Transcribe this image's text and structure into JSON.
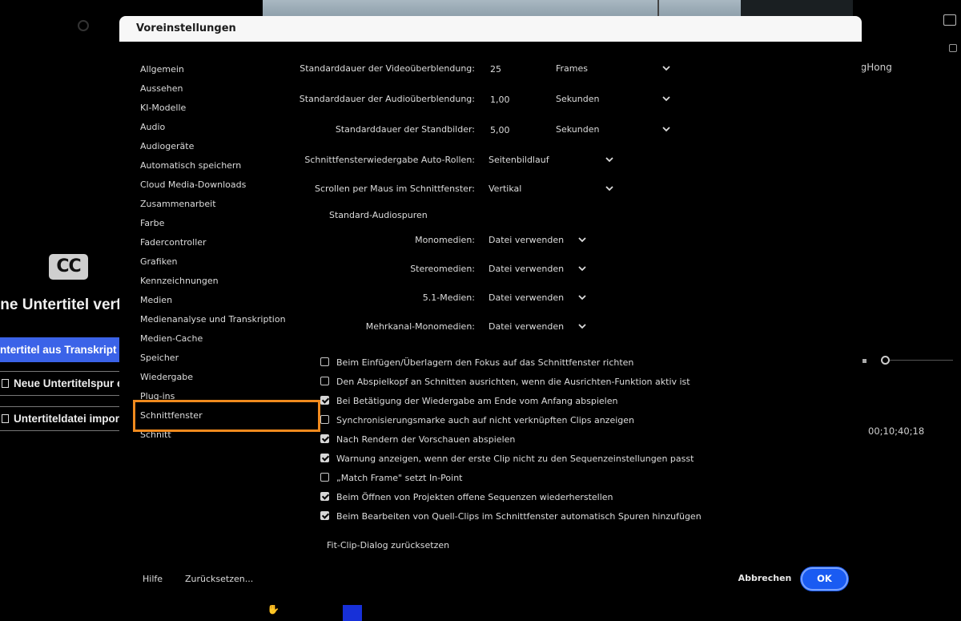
{
  "background": {
    "caption_icon": "CC",
    "title": "ine Untertitel verfü",
    "btn_transcript": "ntertitel aus Transkript ers",
    "btn_new_track": "Neue Untertitelspur ers",
    "btn_import": "Untertiteldatei importi",
    "right_name": "ngHong",
    "timecode": "00;10;40;18"
  },
  "dialog": {
    "title": "Voreinstellungen",
    "sidebar": {
      "items": [
        "Allgemein",
        "Aussehen",
        "KI-Modelle",
        "Audio",
        "Audiogeräte",
        "Automatisch speichern",
        "Cloud Media-Downloads",
        "Zusammenarbeit",
        "Farbe",
        "Fadercontroller",
        "Grafiken",
        "Kennzeichnungen",
        "Medien",
        "Medienanalyse und Transkription",
        "Medien-Cache",
        "Speicher",
        "Wiedergabe",
        "Plug-ins",
        "Schnittfenster",
        "Schnitt"
      ],
      "selected": "Schnittfenster",
      "highlight_color": "#f08a1e"
    },
    "settings": {
      "video_transition": {
        "label": "Standarddauer der Videoüberblendung:",
        "value": "25",
        "unit": "Frames"
      },
      "audio_transition": {
        "label": "Standarddauer der Audioüberblendung:",
        "value": "1,00",
        "unit": "Sekunden"
      },
      "still_duration": {
        "label": "Standarddauer der Standbilder:",
        "value": "5,00",
        "unit": "Sekunden"
      },
      "auto_scroll": {
        "label": "Schnittfensterwiedergabe Auto-Rollen:",
        "value": "Seitenbildlauf"
      },
      "mouse_scroll": {
        "label": "Scrollen per Maus im Schnittfenster:",
        "value": "Vertikal"
      },
      "audio_tracks_heading": "Standard-Audiospuren",
      "mono": {
        "label": "Monomedien:",
        "value": "Datei verwenden"
      },
      "stereo": {
        "label": "Stereomedien:",
        "value": "Datei verwenden"
      },
      "five_one": {
        "label": "5.1-Medien:",
        "value": "Datei verwenden"
      },
      "multichannel": {
        "label": "Mehrkanal-Monomedien:",
        "value": "Datei verwenden"
      }
    },
    "checkboxes": [
      {
        "label": "Beim Einfügen/Überlagern den Fokus auf das Schnittfenster richten",
        "checked": false
      },
      {
        "label": "Den Abspielkopf an Schnitten ausrichten, wenn die Ausrichten-Funktion aktiv ist",
        "checked": false
      },
      {
        "label": "Bei Betätigung der Wiedergabe am Ende vom Anfang abspielen",
        "checked": true
      },
      {
        "label": "Synchronisierungsmarke auch auf nicht verknüpften Clips anzeigen",
        "checked": false
      },
      {
        "label": "Nach Rendern der Vorschauen abspielen",
        "checked": true
      },
      {
        "label": "Warnung anzeigen, wenn der erste Clip nicht zu den Sequenzeinstellungen passt",
        "checked": true
      },
      {
        "label": "„Match Frame\" setzt In-Point",
        "checked": false
      },
      {
        "label": "Beim Öffnen von Projekten offene Sequenzen wiederherstellen",
        "checked": true
      },
      {
        "label": "Beim Bearbeiten von Quell-Clips im Schnittfenster automatisch Spuren hinzufügen",
        "checked": true
      }
    ],
    "reset_fit_clip": "Fit-Clip-Dialog zurücksetzen",
    "footer": {
      "help": "Hilfe",
      "reset": "Zurücksetzen...",
      "cancel": "Abbrechen",
      "ok": "OK"
    },
    "colors": {
      "accent": "#1a5bf2",
      "titlebar": "#f7f7f7"
    }
  }
}
